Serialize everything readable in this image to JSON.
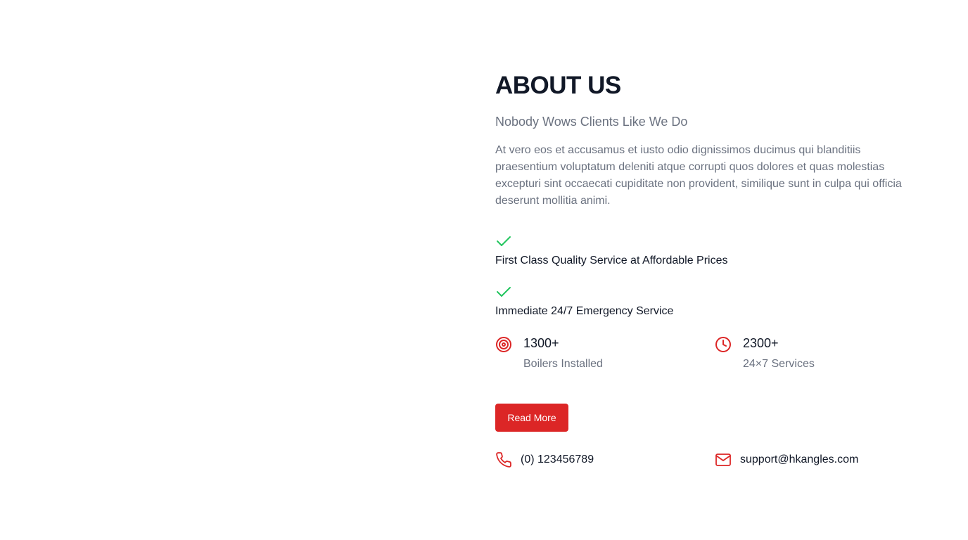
{
  "about": {
    "title": "ABOUT US",
    "subtitle": "Nobody Wows Clients Like We Do",
    "description": "At vero eos et accusamus et iusto odio dignissimos ducimus qui blanditiis praesentium voluptatum deleniti atque corrupti quos dolores et quas molestias excepturi sint occaecati cupiditate non provident, similique sunt in culpa qui officia deserunt mollitia animi.",
    "features": [
      {
        "icon": "check-icon",
        "text": "First Class Quality Service at Affordable Prices"
      },
      {
        "icon": "check-icon",
        "text": "Immediate 24/7 Emergency Service"
      }
    ],
    "stats": [
      {
        "icon": "target-icon",
        "value": "1300+",
        "label": "Boilers Installed"
      },
      {
        "icon": "clock-icon",
        "value": "2300+",
        "label": "24×7 Services"
      }
    ],
    "read_more_label": "Read More",
    "contacts": [
      {
        "icon": "phone-icon",
        "text": "(0) 123456789"
      },
      {
        "icon": "mail-icon",
        "text": "support@hkangles.com"
      }
    ]
  },
  "colors": {
    "accent": "#dc2626",
    "check": "#22c55e",
    "heading": "#111827",
    "muted": "#6b7280"
  }
}
